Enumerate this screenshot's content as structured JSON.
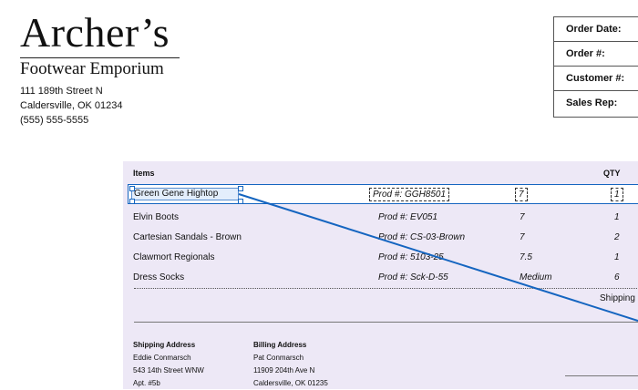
{
  "brand": {
    "name": "Archer’s",
    "subtitle": "Footwear Emporium"
  },
  "address": [
    "111 189th Street N",
    "Caldersville, OK 01234",
    "(555) 555-5555"
  ],
  "order_fields": [
    "Order Date:",
    "Order #:",
    "Customer #:",
    "Sales Rep:"
  ],
  "table": {
    "headers": {
      "items": "Items",
      "qty": "QTY"
    },
    "rows": [
      {
        "name": "Green Gene Hightop",
        "prod": "Prod #: GGH8501",
        "size": "7",
        "qty": "1"
      },
      {
        "name": "Elvin Boots",
        "prod": "Prod #: EV051",
        "size": "7",
        "qty": "1"
      },
      {
        "name": "Cartesian Sandals - Brown",
        "prod": "Prod #: CS-03-Brown",
        "size": "7",
        "qty": "2"
      },
      {
        "name": "Clawmort Regionals",
        "prod": "Prod #: 5103-25",
        "size": "7.5",
        "qty": "1"
      },
      {
        "name": "Dress Socks",
        "prod": "Prod #: Sck-D-55",
        "size": "Medium",
        "qty": "6"
      }
    ],
    "shipping_label": "Shipping a"
  },
  "shipping_address": {
    "title": "Shipping Address",
    "lines": [
      "Eddie Conmarsch",
      "543 14th Street WNW",
      "Apt. #5b"
    ]
  },
  "billing_address": {
    "title": "Billing Address",
    "lines": [
      "Pat Conmarsch",
      "11909 204th Ave N",
      "Caldersville, OK 01235"
    ]
  },
  "colors": {
    "selection": "#1565c0",
    "panel": "#ede8f6"
  }
}
